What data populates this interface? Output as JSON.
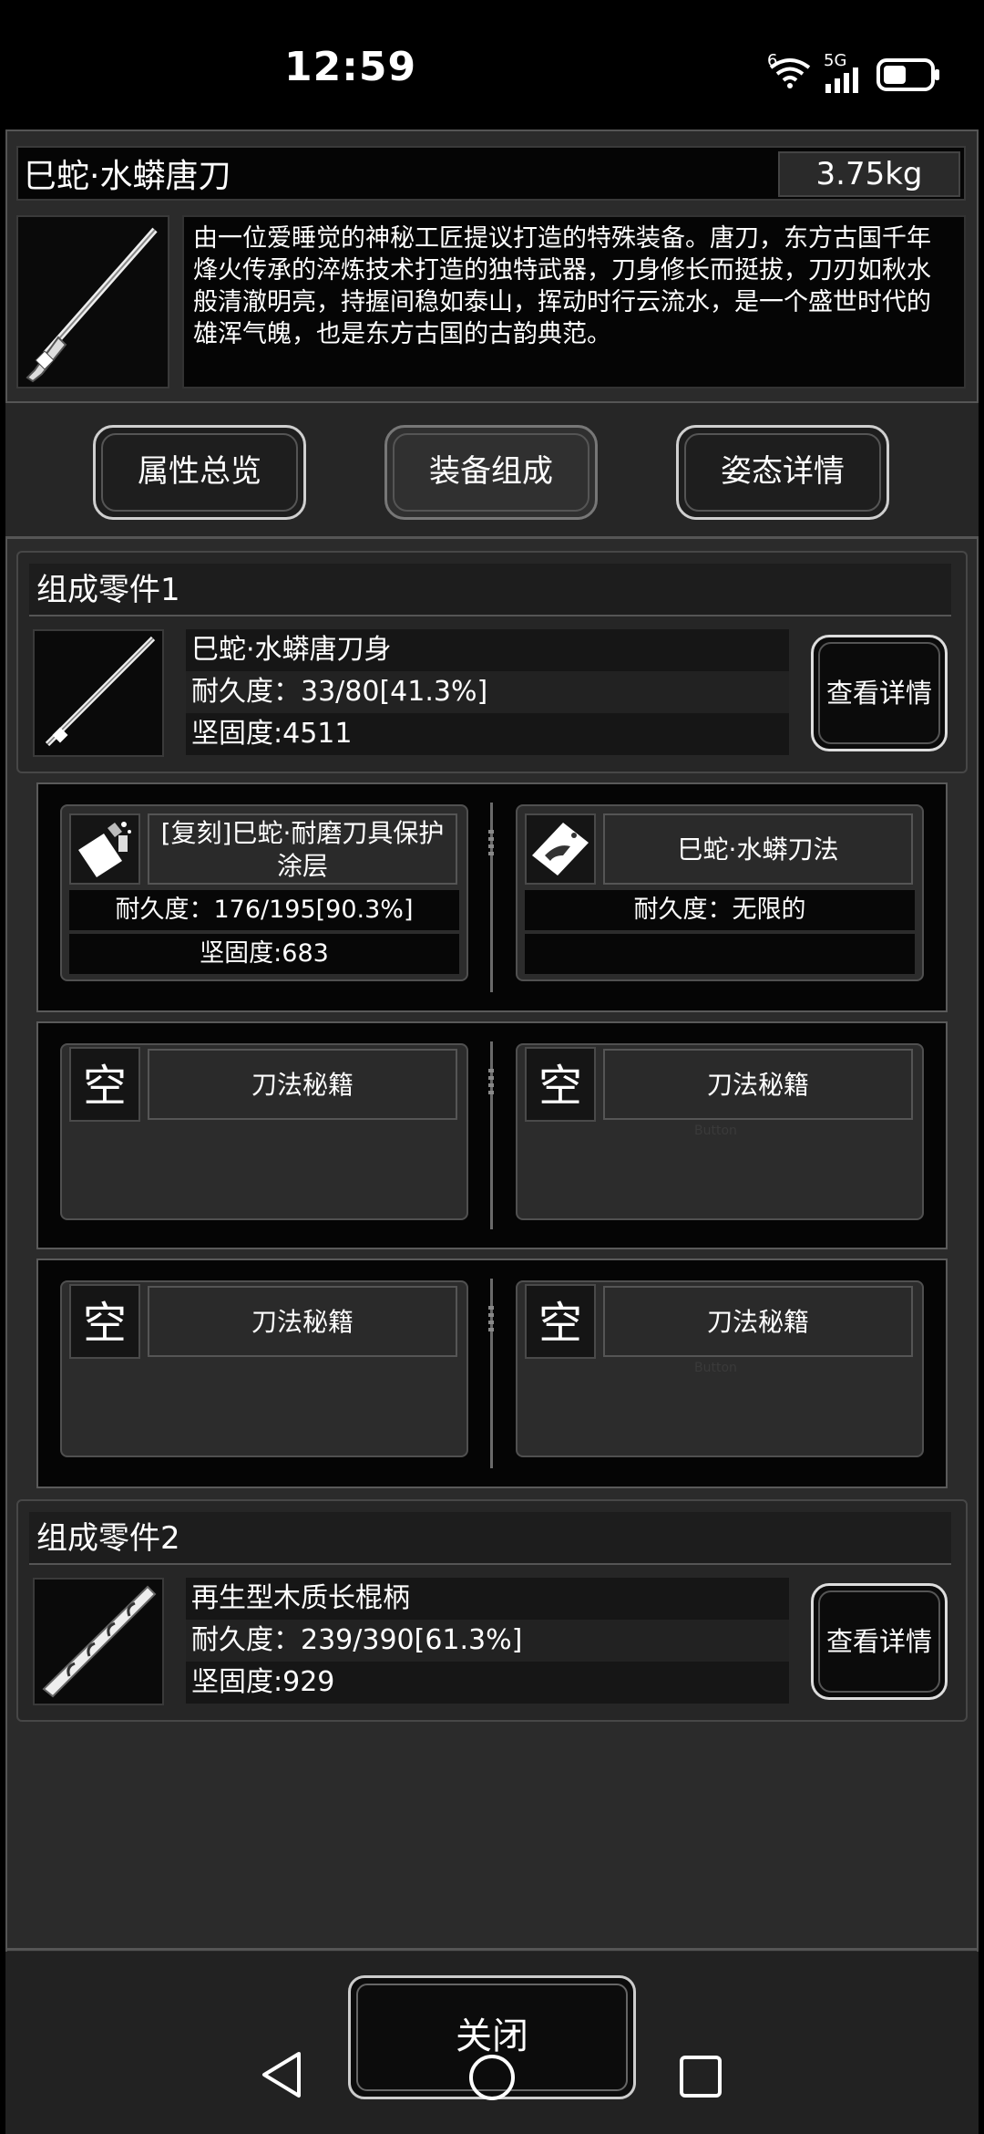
{
  "status": {
    "time": "12:59",
    "network_a": "6",
    "network_b": "5G"
  },
  "item": {
    "title": "巳蛇·水蟒唐刀",
    "weight": "3.75kg",
    "description": "由一位爱睡觉的神秘工匠提议打造的特殊装备。唐刀，东方古国千年烽火传承的淬炼技术打造的独特武器，刀身修长而挺拔，刀刃如秋水般清澈明亮，持握间稳如泰山，挥动时行云流水，是一个盛世时代的雄浑气魄，也是东方古国的古韵典范。"
  },
  "tabs": [
    "属性总览",
    "装备组成",
    "姿态详情"
  ],
  "parts": [
    {
      "heading": "组成零件1",
      "name": "巳蛇·水蟒唐刀身",
      "durability": "耐久度：33/80[41.3%]",
      "hardness": "坚固度:4511",
      "button": "查看详情"
    },
    {
      "heading": "组成零件2",
      "name": "再生型木质长棍柄",
      "durability": "耐久度：239/390[61.3%]",
      "hardness": "坚固度:929",
      "button": "查看详情"
    }
  ],
  "slots": {
    "coating": {
      "name": "[复刻]巳蛇·耐磨刀具保护涂层",
      "durability": "耐久度：176/195[90.3%]",
      "hardness": "坚固度:683"
    },
    "technique": {
      "name": "巳蛇·水蟒刀法",
      "durability": "耐久度：无限的"
    },
    "empty_char": "空",
    "empty_name": "刀法秘籍",
    "ghost_label": "Button"
  },
  "close_label": "关闭"
}
